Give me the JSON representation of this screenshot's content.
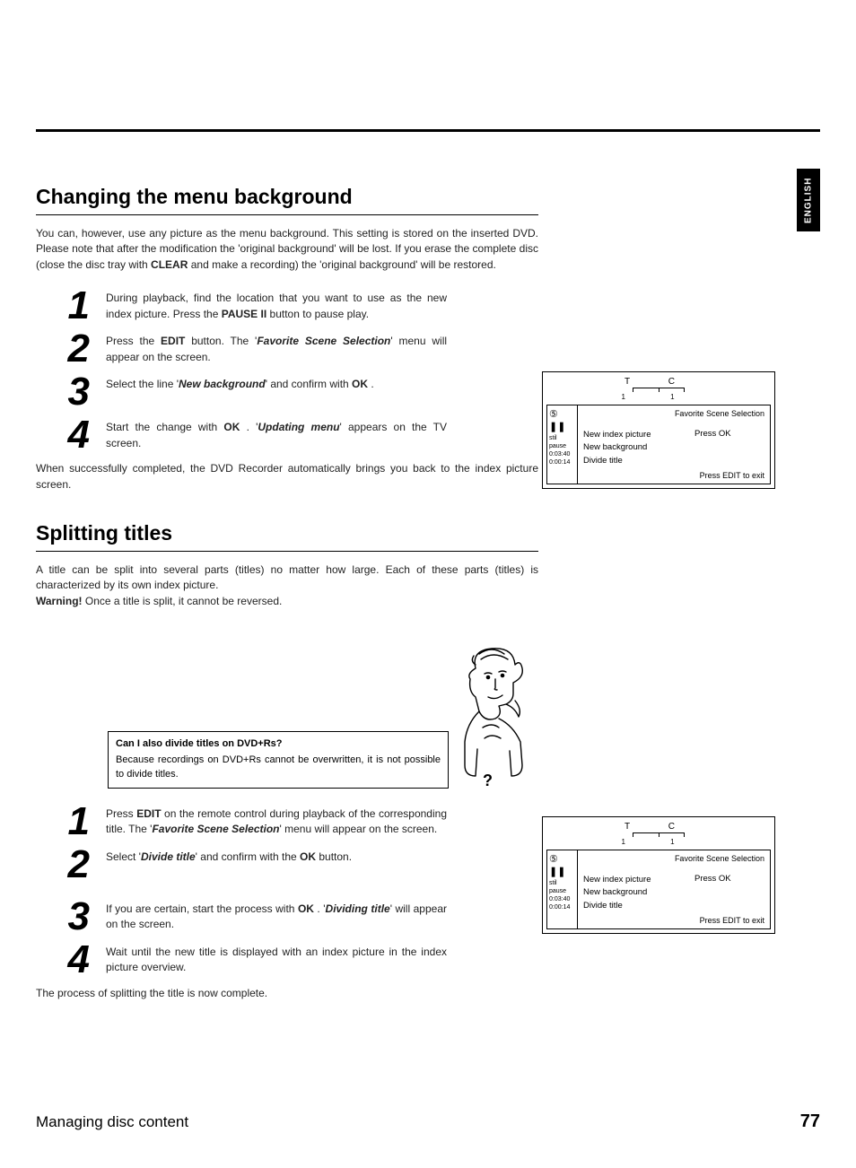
{
  "language_tab": "ENGLISH",
  "section1": {
    "heading": "Changing the menu background",
    "intro_parts": [
      "You can, however, use any picture as the menu background. This setting is stored on the inserted DVD. Please note that after the modification the 'original background' will be lost. If you erase the complete disc (close the disc tray with ",
      "CLEAR",
      " and make a recording) the 'original background' will be restored."
    ],
    "steps": [
      {
        "num": "1",
        "parts": [
          "During playback, find the location that you want to use as the new index picture. Press the ",
          "PAUSE II",
          " button to pause play."
        ]
      },
      {
        "num": "2",
        "parts": [
          "Press the ",
          "EDIT",
          " button. The '",
          "Favorite Scene Selection",
          "' menu will appear on the screen."
        ],
        "bold_idx": [
          1
        ],
        "bi_idx": [
          3
        ]
      },
      {
        "num": "3",
        "parts": [
          "Select the line '",
          "New background",
          "' and confirm with ",
          "OK",
          " ."
        ],
        "bi_idx": [
          1
        ],
        "bold_idx": [
          3
        ]
      },
      {
        "num": "4",
        "parts": [
          "Start the change with ",
          "OK",
          " . '",
          "Updating menu",
          "' appears on the TV screen."
        ],
        "bold_idx": [
          1
        ],
        "bi_idx": [
          3
        ]
      }
    ],
    "closing": "When successfully completed, the DVD Recorder automatically brings you back to the index picture screen."
  },
  "section2": {
    "heading": "Splitting titles",
    "intro_parts": [
      "A title can be split into several parts (titles) no matter how large. Each of these parts (titles) is characterized by its own index picture."
    ],
    "warning_label": "Warning!",
    "warning_text": " Once a title is split, it cannot be reversed.",
    "note_q": "Can I also divide titles on DVD+Rs?",
    "note_a": "Because recordings on DVD+Rs cannot be overwritten, it is not possible to divide titles.",
    "qmark": "?",
    "steps": [
      {
        "num": "1",
        "parts": [
          "Press ",
          "EDIT",
          " on the remote control during playback of the corresponding title. The '",
          "Favorite Scene Selection",
          "' menu will appear on the screen."
        ],
        "bold_idx": [
          1
        ],
        "bi_idx": [
          3
        ]
      },
      {
        "num": "2",
        "parts": [
          "Select '",
          "Divide title",
          "' and confirm with the ",
          "OK",
          " button."
        ],
        "bi_idx": [
          1
        ],
        "bold_idx": [
          3
        ]
      },
      {
        "num": "3",
        "parts": [
          "If you are certain, start the process with ",
          "OK",
          " . '",
          "Dividing title",
          "' will appear on the screen."
        ],
        "bold_idx": [
          1
        ],
        "bi_idx": [
          3
        ]
      },
      {
        "num": "4",
        "parts": [
          "Wait until the new title is displayed with an index picture in the index picture overview."
        ]
      }
    ],
    "closing": "The process of splitting the title is now complete."
  },
  "screen": {
    "letters": "T C",
    "nums": "1 1",
    "side_sym": "⑤ ❚❚",
    "side_lines": [
      "stil  pause",
      "0:03:40",
      "0:00:14"
    ],
    "title": "Favorite Scene Selection",
    "options": [
      "New index picture",
      "New background",
      "Divide title"
    ],
    "col2": "Press OK",
    "exit": "Press EDIT to exit"
  },
  "footer": {
    "title": "Managing disc content",
    "page": "77"
  }
}
